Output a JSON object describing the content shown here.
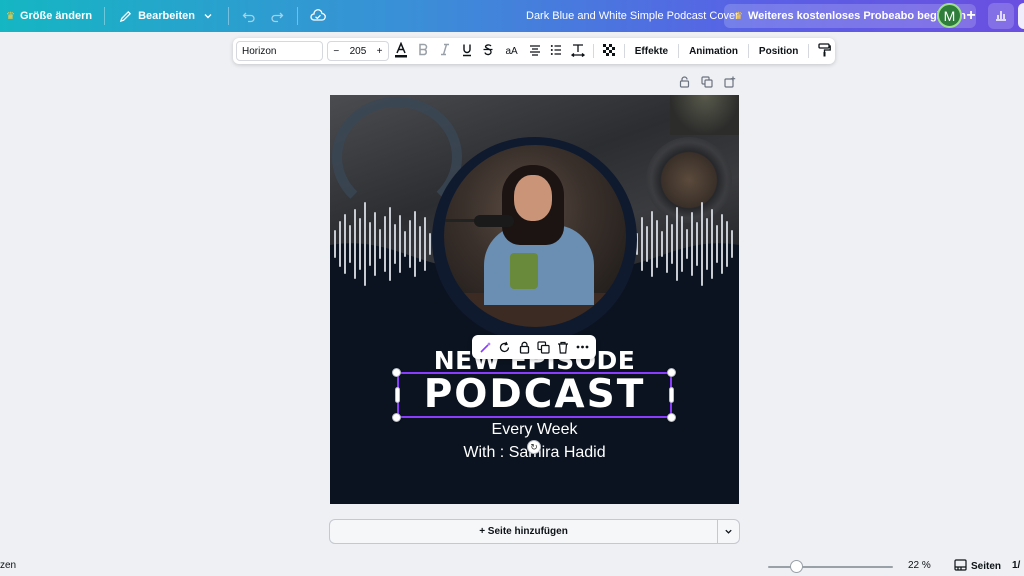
{
  "topbar": {
    "resize_label": "Größe ändern",
    "edit_label": "Bearbeiten",
    "doc_title": "Dark Blue and White Simple Podcast Cover",
    "trial_label": "Weiteres kostenloses Probeabo beginnen",
    "avatar_letter": "M",
    "plus_label": "+"
  },
  "text_toolbar": {
    "font_name": "Horizon",
    "minus": "−",
    "font_size": "205",
    "plus": "+",
    "case_label": "aA",
    "effects_label": "Effekte",
    "animation_label": "Animation",
    "position_label": "Position"
  },
  "canvas": {
    "episode_label": "NEW EPISODE",
    "title": "PODCAST",
    "subtitle": "Every Week",
    "host": "With : Samira Hadid",
    "colors": {
      "background": "#0b1320",
      "text": "#ffffff",
      "selection": "#8b3dff"
    }
  },
  "add_page": {
    "label": "+ Seite hinzufügen"
  },
  "bottom": {
    "left_text": "zen",
    "zoom_value": "22 %",
    "zoom_fraction": 0.2,
    "pages_label": "Seiten",
    "page_count": "1/"
  },
  "icons": {
    "topbar": [
      "crown-icon",
      "pencil-icon",
      "chevron-down-icon",
      "undo-icon",
      "redo-icon",
      "cloud-save-icon",
      "bar-chart-icon"
    ],
    "text_toolbar": [
      "text-color-icon",
      "bold-icon",
      "italic-icon",
      "underline-icon",
      "strikethrough-icon",
      "align-center-icon",
      "list-icon",
      "spacing-icon",
      "transparency-icon",
      "paint-roller-icon"
    ],
    "context_menu": [
      "magic-icon",
      "rotate-icon",
      "lock-icon",
      "duplicate-icon",
      "trash-icon",
      "more-icon"
    ]
  }
}
